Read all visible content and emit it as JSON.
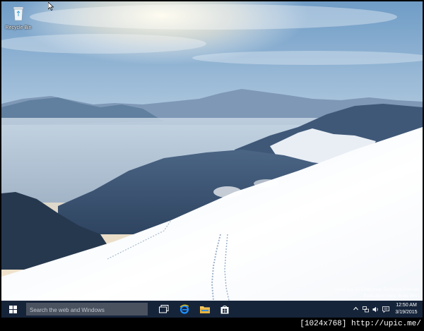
{
  "desktop": {
    "icons": [
      {
        "label": "Recycle Bin",
        "icon": "recycle-bin-icon"
      }
    ],
    "watermark": {
      "line1": "Windows 10 Enterprise Technical Preview",
      "line2": "Evaluation copy. Build 9841"
    }
  },
  "taskbar": {
    "start_icon": "windows-logo-icon",
    "search_placeholder": "Search the web and Windows",
    "pinned": [
      {
        "icon": "task-view-icon"
      },
      {
        "icon": "internet-explorer-icon"
      },
      {
        "icon": "file-explorer-icon"
      },
      {
        "icon": "store-icon"
      }
    ],
    "tray": {
      "icons": [
        "chevron-up-icon",
        "network-icon",
        "volume-icon",
        "action-center-icon"
      ],
      "time": "12:50 AM",
      "date": "3/19/2015"
    }
  },
  "caption": "[1024x768] http://upic.me/",
  "colors": {
    "taskbar": "#16243a",
    "search_box": "#4a5260",
    "accent_blue": "#1e90ff"
  }
}
